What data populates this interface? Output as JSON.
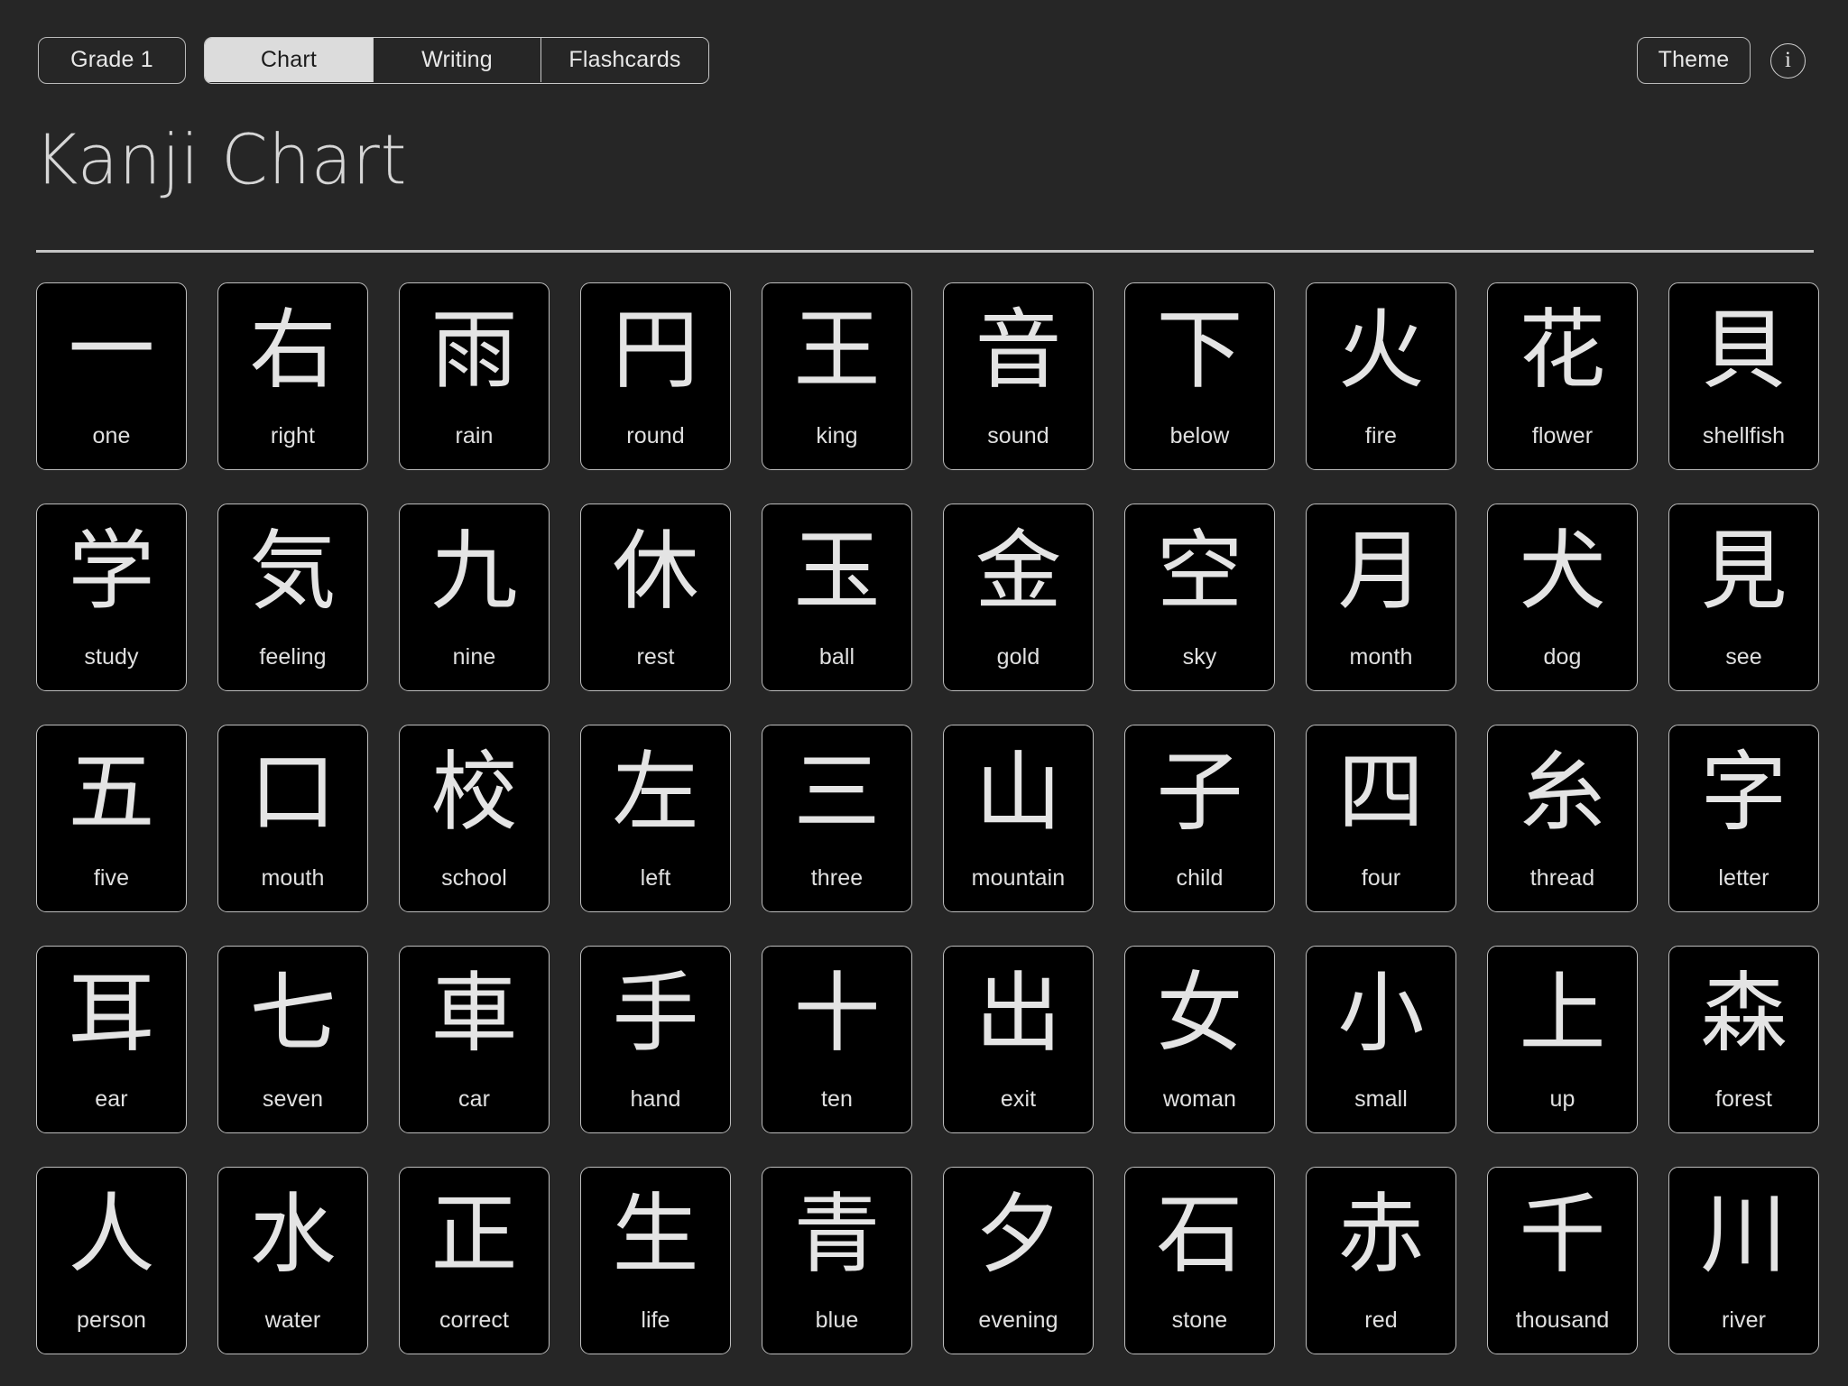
{
  "app": {
    "background_color": "#262626",
    "card_background_color": "#000000",
    "border_color": "#bdbdbd",
    "accent_text_color": "#e4e4e4"
  },
  "header": {
    "grade_label": "Grade 1",
    "theme_label": "Theme",
    "info_label": "i",
    "info_icon": "info-circle-icon",
    "tabs": [
      {
        "label": "Chart",
        "selected": true
      },
      {
        "label": "Writing",
        "selected": false
      },
      {
        "label": "Flashcards",
        "selected": false
      }
    ]
  },
  "main": {
    "title": "Kanji Chart",
    "columns": 10,
    "rows": 5,
    "cards": [
      {
        "kanji": "一",
        "meaning": "one"
      },
      {
        "kanji": "右",
        "meaning": "right"
      },
      {
        "kanji": "雨",
        "meaning": "rain"
      },
      {
        "kanji": "円",
        "meaning": "round"
      },
      {
        "kanji": "王",
        "meaning": "king"
      },
      {
        "kanji": "音",
        "meaning": "sound"
      },
      {
        "kanji": "下",
        "meaning": "below"
      },
      {
        "kanji": "火",
        "meaning": "fire"
      },
      {
        "kanji": "花",
        "meaning": "flower"
      },
      {
        "kanji": "貝",
        "meaning": "shellfish"
      },
      {
        "kanji": "学",
        "meaning": "study"
      },
      {
        "kanji": "気",
        "meaning": "feeling"
      },
      {
        "kanji": "九",
        "meaning": "nine"
      },
      {
        "kanji": "休",
        "meaning": "rest"
      },
      {
        "kanji": "玉",
        "meaning": "ball"
      },
      {
        "kanji": "金",
        "meaning": "gold"
      },
      {
        "kanji": "空",
        "meaning": "sky"
      },
      {
        "kanji": "月",
        "meaning": "month"
      },
      {
        "kanji": "犬",
        "meaning": "dog"
      },
      {
        "kanji": "見",
        "meaning": "see"
      },
      {
        "kanji": "五",
        "meaning": "five"
      },
      {
        "kanji": "口",
        "meaning": "mouth"
      },
      {
        "kanji": "校",
        "meaning": "school"
      },
      {
        "kanji": "左",
        "meaning": "left"
      },
      {
        "kanji": "三",
        "meaning": "three"
      },
      {
        "kanji": "山",
        "meaning": "mountain"
      },
      {
        "kanji": "子",
        "meaning": "child"
      },
      {
        "kanji": "四",
        "meaning": "four"
      },
      {
        "kanji": "糸",
        "meaning": "thread"
      },
      {
        "kanji": "字",
        "meaning": "letter"
      },
      {
        "kanji": "耳",
        "meaning": "ear"
      },
      {
        "kanji": "七",
        "meaning": "seven"
      },
      {
        "kanji": "車",
        "meaning": "car"
      },
      {
        "kanji": "手",
        "meaning": "hand"
      },
      {
        "kanji": "十",
        "meaning": "ten"
      },
      {
        "kanji": "出",
        "meaning": "exit"
      },
      {
        "kanji": "女",
        "meaning": "woman"
      },
      {
        "kanji": "小",
        "meaning": "small"
      },
      {
        "kanji": "上",
        "meaning": "up"
      },
      {
        "kanji": "森",
        "meaning": "forest"
      },
      {
        "kanji": "人",
        "meaning": "person"
      },
      {
        "kanji": "水",
        "meaning": "water"
      },
      {
        "kanji": "正",
        "meaning": "correct"
      },
      {
        "kanji": "生",
        "meaning": "life"
      },
      {
        "kanji": "青",
        "meaning": "blue"
      },
      {
        "kanji": "夕",
        "meaning": "evening"
      },
      {
        "kanji": "石",
        "meaning": "stone"
      },
      {
        "kanji": "赤",
        "meaning": "red"
      },
      {
        "kanji": "千",
        "meaning": "thousand"
      },
      {
        "kanji": "川",
        "meaning": "river"
      }
    ]
  }
}
